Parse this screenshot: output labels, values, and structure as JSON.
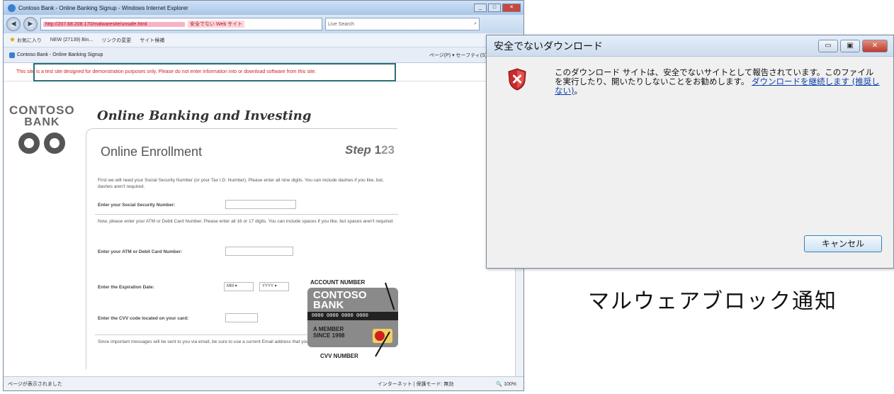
{
  "browser": {
    "title": "Contoso Bank - Online Banking Signup - Windows Internet Explorer",
    "url": "http://207.68.208.170/malwaresite/unsafe.html",
    "address_warning": "安全でない Web サイト",
    "search_placeholder": "Live Search",
    "favorites_label": "お気に入り",
    "fav_items": [
      "NEW (27139) Bin...",
      "リンクの変更",
      "サイト候補"
    ],
    "tab_title": "Contoso Bank - Online Banking Signup",
    "toolbar_tools": "ページ(P) ▾  セーフティ(S) ▾  ツール(O) ▾",
    "status_left": "ページが表示されました",
    "status_zone": "インターネット | 保護モード: 無効",
    "status_zoom": "100%"
  },
  "site": {
    "warning": "This site is a test site designed for demonstration purposes only. Please do not enter information into or download software from this site.",
    "logo_line1": "CONTOSO",
    "logo_line2": "BANK",
    "heading": "Online Banking and Investing",
    "enroll_title": "Online Enrollment",
    "step_word": "Step",
    "step_nums": [
      "1",
      "2",
      "3"
    ],
    "intro_text": "First we will need your Social Security Number (or your Tax I.D. Number). Please enter all nine digits. You can include dashes if you like, but, dashes aren't required.",
    "ssn_label": "Enter your Social Security Number:",
    "card_intro": "Now, please enter your ATM or Debit Card Number. Please enter all 16 or 17 digits. You can include spaces if you like, but spaces aren't required.",
    "card_label": "Enter your ATM or Debit Card Number:",
    "exp_label": "Enter the Expiration Date:",
    "exp_month": "MM",
    "exp_year": "YYYY",
    "cvv_label": "Enter the CVV code located on your card:",
    "email_text": "Since important messages will be sent to you via email, be sure to use a current Email address that you plan on checking often.",
    "account_number_label": "ACCOUNT NUMBER",
    "cvv_number_label": "CVV NUMBER",
    "card_brand_1": "CONTOSO",
    "card_brand_2": "BANK",
    "card_number": "0000 0000 0000 0000",
    "card_member": "A MEMBER",
    "card_since": "SINCE 1998"
  },
  "dialog": {
    "title": "安全でないダウンロード",
    "message": "このダウンロード サイトは、安全でないサイトとして報告されています。このファイルを実行したり、開いたりしないことをお勧めします。",
    "link": "ダウンロードを継続します (推奨しない)",
    "link_tail": "。",
    "cancel": "キャンセル"
  },
  "caption": "マルウェアブロック通知"
}
